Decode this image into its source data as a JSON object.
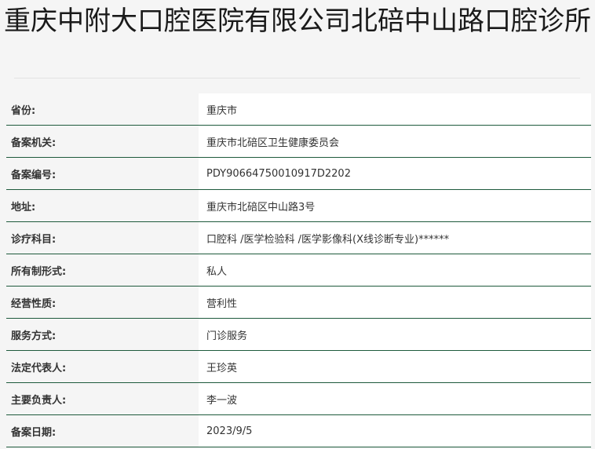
{
  "title": "重庆中附大口腔医院有限公司北碚中山路口腔诊所",
  "rows": [
    {
      "label": "省份:",
      "value": "重庆市"
    },
    {
      "label": "备案机关:",
      "value": "重庆市北碚区卫生健康委员会"
    },
    {
      "label": "备案编号:",
      "value": "PDY90664750010917D2202"
    },
    {
      "label": "地址:",
      "value": "重庆市北碚区中山路3号"
    },
    {
      "label": "诊疗科目:",
      "value": "口腔科 /医学检验科 /医学影像科(X线诊断专业)******"
    },
    {
      "label": "所有制形式:",
      "value": "私人"
    },
    {
      "label": "经营性质:",
      "value": "营利性"
    },
    {
      "label": "服务方式:",
      "value": "门诊服务"
    },
    {
      "label": "法定代表人:",
      "value": "王珍英"
    },
    {
      "label": "主要负责人:",
      "value": "李一波"
    },
    {
      "label": "备案日期:",
      "value": "2023/9/5"
    }
  ]
}
